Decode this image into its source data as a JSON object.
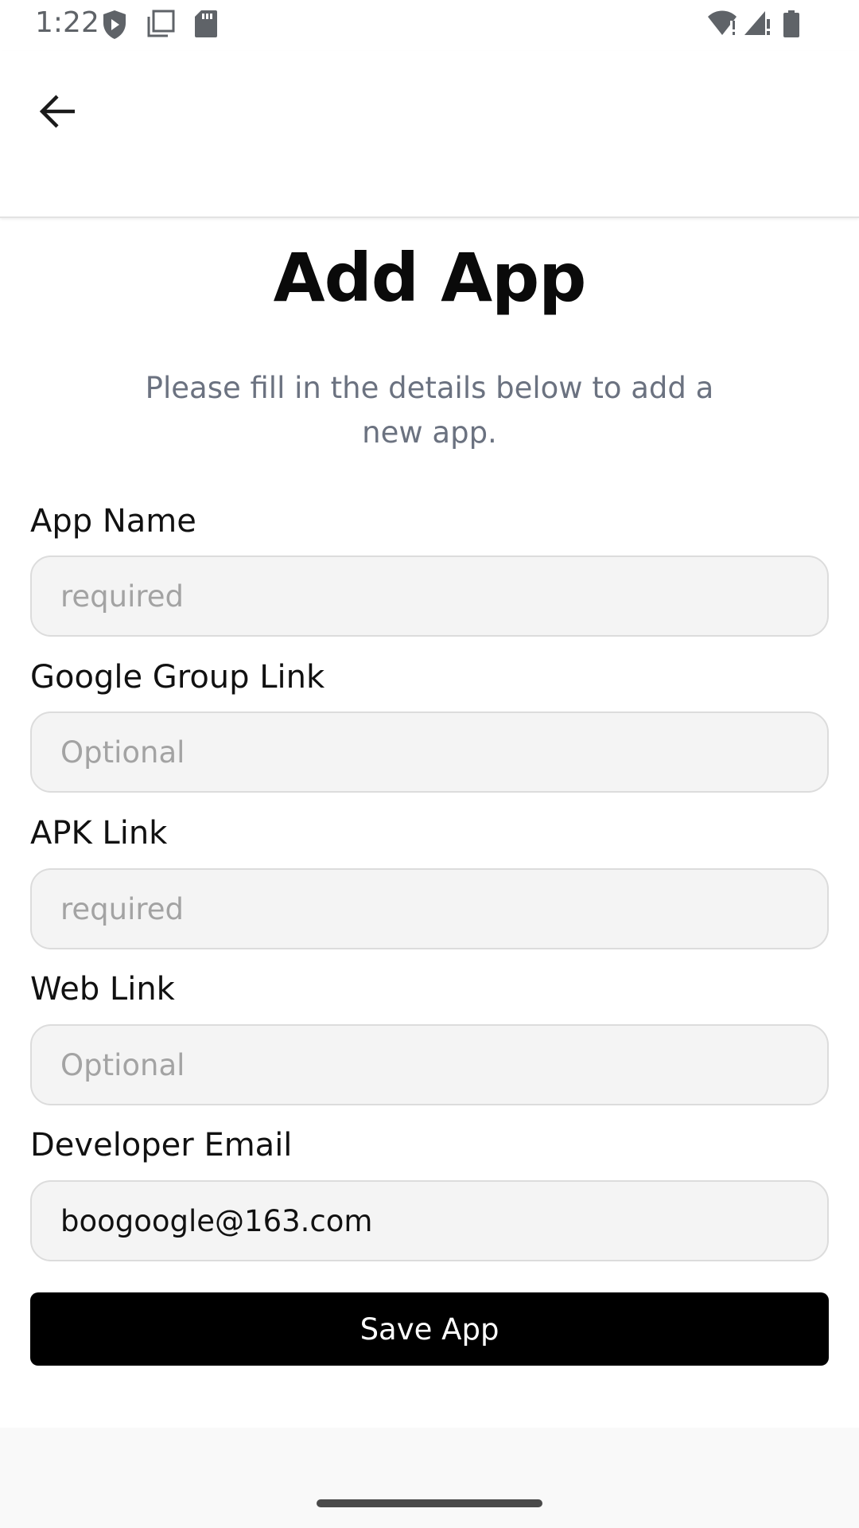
{
  "status_bar": {
    "time": "1:22",
    "icons_left": [
      "shield-play-icon",
      "copy-icon",
      "sd-card-icon"
    ],
    "icons_right": [
      "wifi-alert-icon",
      "signal-alert-icon",
      "battery-icon"
    ]
  },
  "app_bar": {
    "back_icon": "arrow-back-icon"
  },
  "page": {
    "title": "Add App",
    "subtitle": "Please fill in the details below to add a new app."
  },
  "form": {
    "app_name": {
      "label": "App Name",
      "value": "",
      "placeholder": "required"
    },
    "google_group_link": {
      "label": "Google Group Link",
      "value": "",
      "placeholder": "Optional"
    },
    "apk_link": {
      "label": "APK Link",
      "value": "",
      "placeholder": "required"
    },
    "web_link": {
      "label": "Web Link",
      "value": "",
      "placeholder": "Optional"
    },
    "developer_email": {
      "label": "Developer Email",
      "value": "boogoogle@163.com",
      "placeholder": ""
    },
    "save_label": "Save App"
  },
  "colors": {
    "primary_button": "#000000",
    "input_background": "#f4f4f4",
    "subtitle_text": "#6b7280",
    "placeholder_text": "#a3a3a3"
  }
}
